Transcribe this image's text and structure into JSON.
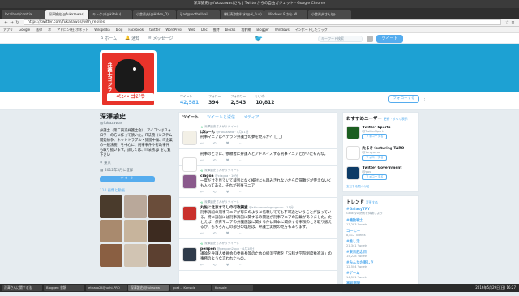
{
  "window_title": "深澤諭史(@fukazawas)さん | Twitterからの自由ガジェット - Google Chrome",
  "browser_tabs": [
    {
      "label": "localhost/contrial"
    },
    {
      "label": "深澤諭史(@fukazawas)"
    },
    {
      "label": "キトクラ(@kitoku)"
    },
    {
      "label": "小倉秀夫(@Hideo_O)"
    },
    {
      "label": "ij.ad@footballvail"
    },
    {
      "label": "(株)清涼飲料水(@N_Kun)"
    },
    {
      "label": "Windows 8 から W"
    },
    {
      "label": "小倉秀夫さん(@"
    }
  ],
  "address": {
    "url": "https://twitter.com/fukazawas/with_replies"
  },
  "bookmarks": [
    "アプリ",
    "Google",
    "法律",
    "ボ",
    "アドロン(社)ボネット",
    "Wikipedia",
    "blog",
    "Facebook",
    "twitter",
    "WordPress",
    "Web",
    "Dec",
    "推特",
    "blocks",
    "我們網",
    "Blogger",
    "Windows",
    "インポートしたブック"
  ],
  "twitter_nav": {
    "home": "ホーム",
    "notifications": "通知",
    "messages": "メッセージ",
    "search_placeholder": "キーワード検索",
    "tweet_button": "ツイート"
  },
  "profile": {
    "logo_side": "弁護士ゴジラ",
    "logo_bottom": "ペン・ゴジラ",
    "name": "深澤諭史",
    "handle": "@fukazawas",
    "bio": "弁護士（第二東京弁護士会）。アイコンはフォロワーの方に作って頂いた。IT法務（システム開発紛争、ネットトラブル・誹謗中傷、IT企業の一般法務）を中心に、刑事事件や行政事件も取り扱います。詳しくは、IT法務.jp をご覧下さい",
    "location": "東京",
    "joined": "2012年3月に登録",
    "tweet_to": "ツイート",
    "media_label": "114 画像と動画"
  },
  "stats": [
    {
      "label": "ツイート",
      "value": "42,581"
    },
    {
      "label": "フォロー",
      "value": "394"
    },
    {
      "label": "フォロワー",
      "value": "2,543"
    },
    {
      "label": "いいね",
      "value": "10,812"
    }
  ],
  "follow_button": "フォローする",
  "timeline_tabs": [
    "ツイート",
    "ツイートと返信",
    "メディア"
  ],
  "tweets": [
    {
      "context": "深澤諭史さんがリツイート",
      "author": "ばね一ん",
      "handle": "@fukazawa · 4月11日",
      "text": "刑事マニアはペテラン弁護士の夢を見るか？ [_ _]",
      "reply": "",
      "rt": "",
      "like": "",
      "avatar_color": "#f3f0e6"
    },
    {
      "context": "",
      "author": "",
      "handle": "",
      "text": "刑事のときに、依頼者に弁護人とアドバイスする刑事マニアとかいたもんな。",
      "reply": "",
      "rt": "",
      "like": "",
      "avatar_color": "#ffffff"
    },
    {
      "context": "深澤諭史さんがリツイート",
      "author": "ciagoa",
      "handle": "@ciagoa · 10分",
      "text": "一度だけを見ていて裁判になく検討にも踏みきれないから自覚難だが使えないくも入ってある。それが刑事マニア",
      "reply": "",
      "rt": "",
      "like": "",
      "avatar_color": "#8a5a8c"
    },
    {
      "context": "深澤諭史さんがリツイート",
      "author": "丸佐に北京すてしの行政調査",
      "handle": "@shinamenlogingmun · 15分",
      "text": "刑事訴訟の刑事マニアが毎日のように信頼してても不可通ということが誤っている。特に訴訟には刑事訴訟に関するの関連が刑事マニアの記載がありました。たとえば、保育マニアの弁護施設に関する件は日本に関係する事項のとき取り扱えるが、もちろんこの部分の理屈は、弁護士実務の見方もあります。",
      "reply": "",
      "rt": "",
      "like": "",
      "avatar_color": "#c9302c"
    },
    {
      "context": "深澤諭史さんがリツイート",
      "author": "penpon",
      "handle": "@penpon2ppn · 4月18日",
      "text": "議論を弁護人委員会の委員長等のための経済学者を「法科大学院制度推進派」の事務のような言われたもの。",
      "reply": "",
      "rt": "",
      "like": "",
      "avatar_color": "#2f3b4a"
    }
  ],
  "who_to_follow": {
    "title": "おすすめユーザー",
    "refresh": "更新 · すべて表示",
    "users": [
      {
        "name": "Twitter Sports",
        "handle": "@TwitterSports",
        "follow": "フォローする",
        "color": "#1b5e20"
      },
      {
        "name": "たるき featuring TARO",
        "handle": "@taroyama",
        "follow": "フォローする",
        "color": "#ffffff"
      },
      {
        "name": "Twitter Government",
        "handle": "@gov",
        "follow": "フォローする",
        "color": "#0d3b66"
      }
    ],
    "footer": "友だちを見つける"
  },
  "trends": {
    "title": "トレンド",
    "change": "変更する",
    "items": [
      {
        "tag": "#GalaxyTRY",
        "desc": "Galaxyの熱気を体験しよう"
      },
      {
        "tag": "#機動戦士",
        "desc": "17,283 Tweets"
      },
      {
        "tag": "コーヒー",
        "desc": "8,812 Tweets"
      },
      {
        "tag": "#推し活",
        "desc": "21,341 Tweets"
      },
      {
        "tag": "#東京記念日",
        "desc": "15,228 Tweets"
      },
      {
        "tag": "#みんなの楽しさ",
        "desc": "12,504 Tweets"
      },
      {
        "tag": "#ゲーム",
        "desc": "14,501 Tweets"
      },
      {
        "tag": "高校野球",
        "desc": "19,876 Tweets"
      }
    ]
  },
  "taskbar": [
    "深澤さんに関する法",
    "Blogger: 書類",
    "ethaco24@uchi-PRO",
    "深澤諭史(@fukazaw",
    "post -- Konsole",
    "Konsole"
  ],
  "clock": "2016年5月29日(日) 16:27",
  "thumbs_colors": [
    "#4a3b2c",
    "#b9a89a",
    "#6a4d3a",
    "#a98a6e",
    "#c7b49c",
    "#3d2b20",
    "#8a5f42",
    "#d1c4b3",
    "#5c4030"
  ]
}
